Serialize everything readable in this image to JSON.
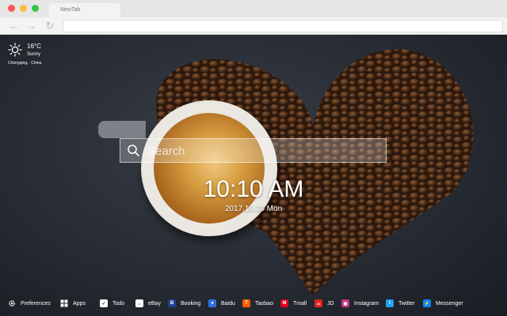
{
  "browser": {
    "tab_title": "NewTab"
  },
  "weather": {
    "temperature": "16°C",
    "condition": "Sunny",
    "location": "Chongqing、China"
  },
  "search": {
    "placeholder": "Search"
  },
  "clock": {
    "time": "10:10 AM",
    "date": "2017.10.30 Mon"
  },
  "dock": {
    "items": [
      {
        "label": "Preferences",
        "icon": "gear-icon",
        "color": "transparent"
      },
      {
        "label": "Apps",
        "icon": "grid-icon",
        "color": "transparent"
      },
      {
        "label": "Todo",
        "icon": "checkbox-icon",
        "color": "#ffffff"
      },
      {
        "label": "eBay",
        "icon": "ebay-icon",
        "color": "#ffffff"
      },
      {
        "label": "Booking",
        "icon": "booking-icon",
        "color": "#1f3f8f"
      },
      {
        "label": "Baidu",
        "icon": "baidu-icon",
        "color": "#2f6fe0"
      },
      {
        "label": "Taobao",
        "icon": "taobao-icon",
        "color": "#ff5a00"
      },
      {
        "label": "Tmall",
        "icon": "tmall-icon",
        "color": "#e0001b"
      },
      {
        "label": "JD",
        "icon": "jd-icon",
        "color": "#e1251b"
      },
      {
        "label": "Instagram",
        "icon": "instagram-icon",
        "color": "#c13584"
      },
      {
        "label": "Twitter",
        "icon": "twitter-icon",
        "color": "#1da1f2"
      },
      {
        "label": "Messenger",
        "icon": "messenger-icon",
        "color": "#0a84ff"
      }
    ]
  }
}
